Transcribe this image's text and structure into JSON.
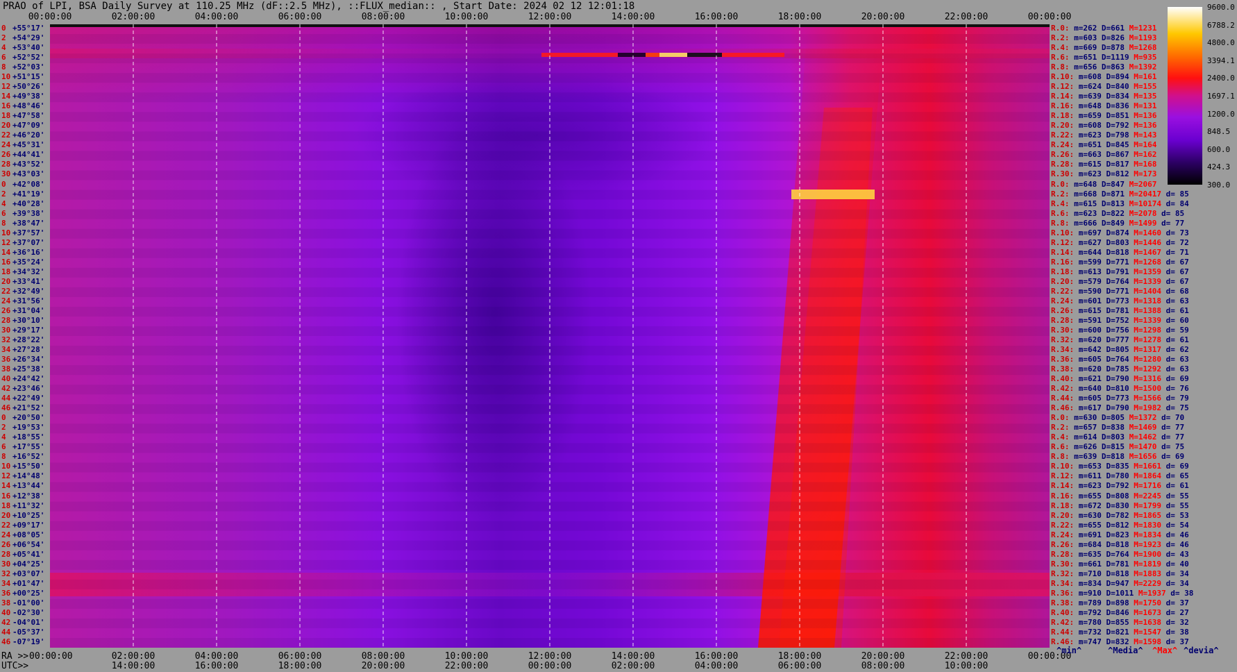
{
  "title": "PRAO of LPI, BSA Daily Survey at 110.25 MHz (dF::2.5 MHz), ::FLUX_median:: , Start Date: 2024 02 12 12:01:18",
  "footer": {
    "ra_label": "RA >>",
    "utc_label": "UTC>>",
    "legend": [
      "^min^",
      "^Media^",
      "^Max^",
      "^devia^"
    ]
  },
  "colors": {
    "background": "#9c9c9c",
    "index": "#cc0000",
    "declination": "#00006e",
    "max": "#ff0000"
  },
  "chart_data": {
    "type": "heatmap",
    "x_top_labels": [
      "00:00:00",
      "02:00:00",
      "04:00:00",
      "06:00:00",
      "08:00:00",
      "10:00:00",
      "12:00:00",
      "14:00:00",
      "16:00:00",
      "18:00:00",
      "20:00:00",
      "22:00:00",
      "00:00:00"
    ],
    "x_bottom_ra": [
      "00:00:00",
      "02:00:00",
      "04:00:00",
      "06:00:00",
      "08:00:00",
      "10:00:00",
      "12:00:00",
      "14:00:00",
      "16:00:00",
      "18:00:00",
      "20:00:00",
      "22:00:00",
      "00:00:00"
    ],
    "x_bottom_utc": [
      "14:00:00",
      "16:00:00",
      "18:00:00",
      "20:00:00",
      "22:00:00",
      "00:00:00",
      "02:00:00",
      "04:00:00",
      "06:00:00",
      "08:00:00",
      "10:00:00"
    ],
    "colorbar": {
      "ticks": [
        "9600.0",
        "6788.2",
        "4800.0",
        "3394.1",
        "2400.0",
        "1697.1",
        "1200.0",
        "848.5",
        "600.0",
        "424.3",
        "300.0"
      ]
    },
    "rows": [
      {
        "i": "0",
        "dec": "+55°17'"
      },
      {
        "i": "2",
        "dec": "+54°29'"
      },
      {
        "i": "4",
        "dec": "+53°40'"
      },
      {
        "i": "6",
        "dec": "+52°52'"
      },
      {
        "i": "8",
        "dec": "+52°03'"
      },
      {
        "i": "10",
        "dec": "+51°15'"
      },
      {
        "i": "12",
        "dec": "+50°26'"
      },
      {
        "i": "14",
        "dec": "+49°38'"
      },
      {
        "i": "16",
        "dec": "+48°46'"
      },
      {
        "i": "18",
        "dec": "+47°58'"
      },
      {
        "i": "20",
        "dec": "+47°09'"
      },
      {
        "i": "22",
        "dec": "+46°20'"
      },
      {
        "i": "24",
        "dec": "+45°31'"
      },
      {
        "i": "26",
        "dec": "+44°41'"
      },
      {
        "i": "28",
        "dec": "+43°52'"
      },
      {
        "i": "30",
        "dec": "+43°03'"
      },
      {
        "i": "0",
        "dec": "+42°08'"
      },
      {
        "i": "2",
        "dec": "+41°19'"
      },
      {
        "i": "4",
        "dec": "+40°28'"
      },
      {
        "i": "6",
        "dec": "+39°38'"
      },
      {
        "i": "8",
        "dec": "+38°47'"
      },
      {
        "i": "10",
        "dec": "+37°57'"
      },
      {
        "i": "12",
        "dec": "+37°07'"
      },
      {
        "i": "14",
        "dec": "+36°16'"
      },
      {
        "i": "16",
        "dec": "+35°24'"
      },
      {
        "i": "18",
        "dec": "+34°32'"
      },
      {
        "i": "20",
        "dec": "+33°41'"
      },
      {
        "i": "22",
        "dec": "+32°49'"
      },
      {
        "i": "24",
        "dec": "+31°56'"
      },
      {
        "i": "26",
        "dec": "+31°04'"
      },
      {
        "i": "28",
        "dec": "+30°10'"
      },
      {
        "i": "30",
        "dec": "+29°17'"
      },
      {
        "i": "32",
        "dec": "+28°22'"
      },
      {
        "i": "34",
        "dec": "+27°28'"
      },
      {
        "i": "36",
        "dec": "+26°34'"
      },
      {
        "i": "38",
        "dec": "+25°38'"
      },
      {
        "i": "40",
        "dec": "+24°42'"
      },
      {
        "i": "42",
        "dec": "+23°46'"
      },
      {
        "i": "44",
        "dec": "+22°49'"
      },
      {
        "i": "46",
        "dec": "+21°52'"
      },
      {
        "i": "0",
        "dec": "+20°50'"
      },
      {
        "i": "2",
        "dec": "+19°53'"
      },
      {
        "i": "4",
        "dec": "+18°55'"
      },
      {
        "i": "6",
        "dec": "+17°55'"
      },
      {
        "i": "8",
        "dec": "+16°52'"
      },
      {
        "i": "10",
        "dec": "+15°50'"
      },
      {
        "i": "12",
        "dec": "+14°48'"
      },
      {
        "i": "14",
        "dec": "+13°44'"
      },
      {
        "i": "16",
        "dec": "+12°38'"
      },
      {
        "i": "18",
        "dec": "+11°32'"
      },
      {
        "i": "20",
        "dec": "+10°25'"
      },
      {
        "i": "22",
        "dec": "+09°17'"
      },
      {
        "i": "24",
        "dec": "+08°05'"
      },
      {
        "i": "26",
        "dec": "+06°54'"
      },
      {
        "i": "28",
        "dec": "+05°41'"
      },
      {
        "i": "30",
        "dec": "+04°25'"
      },
      {
        "i": "32",
        "dec": "+03°07'"
      },
      {
        "i": "34",
        "dec": "+01°47'"
      },
      {
        "i": "36",
        "dec": "+00°25'"
      },
      {
        "i": "38",
        "dec": "-01°00'"
      },
      {
        "i": "40",
        "dec": "-02°30'"
      },
      {
        "i": "42",
        "dec": "-04°01'"
      },
      {
        "i": "44",
        "dec": "-05°37'"
      },
      {
        "i": "46",
        "dec": "-07°19'"
      }
    ],
    "stats": [
      {
        "r": "R.0:",
        "min": "262",
        "med": "661",
        "max": "1231",
        "d": ""
      },
      {
        "r": "R.2:",
        "min": "603",
        "med": "826",
        "max": "1193",
        "d": ""
      },
      {
        "r": "R.4:",
        "min": "669",
        "med": "878",
        "max": "1268",
        "d": ""
      },
      {
        "r": "R.6:",
        "min": "651",
        "med": "1119",
        "max": "935",
        "d": ""
      },
      {
        "r": "R.8:",
        "min": "656",
        "med": "863",
        "max": "1392",
        "d": ""
      },
      {
        "r": "R.10:",
        "min": "608",
        "med": "894",
        "max": "161",
        "d": ""
      },
      {
        "r": "R.12:",
        "min": "624",
        "med": "840",
        "max": "155",
        "d": ""
      },
      {
        "r": "R.14:",
        "min": "639",
        "med": "834",
        "max": "135",
        "d": ""
      },
      {
        "r": "R.16:",
        "min": "648",
        "med": "836",
        "max": "131",
        "d": ""
      },
      {
        "r": "R.18:",
        "min": "659",
        "med": "851",
        "max": "136",
        "d": ""
      },
      {
        "r": "R.20:",
        "min": "608",
        "med": "792",
        "max": "136",
        "d": ""
      },
      {
        "r": "R.22:",
        "min": "623",
        "med": "798",
        "max": "143",
        "d": ""
      },
      {
        "r": "R.24:",
        "min": "651",
        "med": "845",
        "max": "164",
        "d": ""
      },
      {
        "r": "R.26:",
        "min": "663",
        "med": "867",
        "max": "162",
        "d": ""
      },
      {
        "r": "R.28:",
        "min": "615",
        "med": "817",
        "max": "168",
        "d": ""
      },
      {
        "r": "R.30:",
        "min": "623",
        "med": "812",
        "max": "173",
        "d": ""
      },
      {
        "r": "R.0:",
        "min": "648",
        "med": "847",
        "max": "2067",
        "d": ""
      },
      {
        "r": "R.2:",
        "min": "668",
        "med": "871",
        "max": "20417",
        "d": "85"
      },
      {
        "r": "R.4:",
        "min": "615",
        "med": "813",
        "max": "10174",
        "d": "84"
      },
      {
        "r": "R.6:",
        "min": "623",
        "med": "822",
        "max": "2078",
        "d": "85"
      },
      {
        "r": "R.8:",
        "min": "666",
        "med": "849",
        "max": "1499",
        "d": "77"
      },
      {
        "r": "R.10:",
        "min": "697",
        "med": "874",
        "max": "1460",
        "d": "73"
      },
      {
        "r": "R.12:",
        "min": "627",
        "med": "803",
        "max": "1446",
        "d": "72"
      },
      {
        "r": "R.14:",
        "min": "644",
        "med": "818",
        "max": "1467",
        "d": "71"
      },
      {
        "r": "R.16:",
        "min": "599",
        "med": "771",
        "max": "1268",
        "d": "67"
      },
      {
        "r": "R.18:",
        "min": "613",
        "med": "791",
        "max": "1359",
        "d": "67"
      },
      {
        "r": "R.20:",
        "min": "579",
        "med": "764",
        "max": "1339",
        "d": "67"
      },
      {
        "r": "R.22:",
        "min": "590",
        "med": "771",
        "max": "1404",
        "d": "68"
      },
      {
        "r": "R.24:",
        "min": "601",
        "med": "773",
        "max": "1318",
        "d": "63"
      },
      {
        "r": "R.26:",
        "min": "615",
        "med": "781",
        "max": "1388",
        "d": "61"
      },
      {
        "r": "R.28:",
        "min": "591",
        "med": "752",
        "max": "1339",
        "d": "60"
      },
      {
        "r": "R.30:",
        "min": "600",
        "med": "756",
        "max": "1298",
        "d": "59"
      },
      {
        "r": "R.32:",
        "min": "620",
        "med": "777",
        "max": "1278",
        "d": "61"
      },
      {
        "r": "R.34:",
        "min": "642",
        "med": "805",
        "max": "1317",
        "d": "62"
      },
      {
        "r": "R.36:",
        "min": "605",
        "med": "764",
        "max": "1280",
        "d": "63"
      },
      {
        "r": "R.38:",
        "min": "620",
        "med": "785",
        "max": "1292",
        "d": "63"
      },
      {
        "r": "R.40:",
        "min": "621",
        "med": "790",
        "max": "1316",
        "d": "69"
      },
      {
        "r": "R.42:",
        "min": "640",
        "med": "810",
        "max": "1500",
        "d": "76"
      },
      {
        "r": "R.44:",
        "min": "605",
        "med": "773",
        "max": "1566",
        "d": "79"
      },
      {
        "r": "R.46:",
        "min": "617",
        "med": "790",
        "max": "1982",
        "d": "75"
      },
      {
        "r": "R.0:",
        "min": "630",
        "med": "805",
        "max": "1372",
        "d": "70"
      },
      {
        "r": "R.2:",
        "min": "657",
        "med": "838",
        "max": "1469",
        "d": "77"
      },
      {
        "r": "R.4:",
        "min": "614",
        "med": "803",
        "max": "1462",
        "d": "77"
      },
      {
        "r": "R.6:",
        "min": "626",
        "med": "815",
        "max": "1470",
        "d": "75"
      },
      {
        "r": "R.8:",
        "min": "639",
        "med": "818",
        "max": "1656",
        "d": "69"
      },
      {
        "r": "R.10:",
        "min": "653",
        "med": "835",
        "max": "1661",
        "d": "69"
      },
      {
        "r": "R.12:",
        "min": "611",
        "med": "780",
        "max": "1864",
        "d": "65"
      },
      {
        "r": "R.14:",
        "min": "623",
        "med": "792",
        "max": "1716",
        "d": "61"
      },
      {
        "r": "R.16:",
        "min": "655",
        "med": "808",
        "max": "2245",
        "d": "55"
      },
      {
        "r": "R.18:",
        "min": "672",
        "med": "830",
        "max": "1799",
        "d": "55"
      },
      {
        "r": "R.20:",
        "min": "630",
        "med": "782",
        "max": "1865",
        "d": "53"
      },
      {
        "r": "R.22:",
        "min": "655",
        "med": "812",
        "max": "1830",
        "d": "54"
      },
      {
        "r": "R.24:",
        "min": "691",
        "med": "823",
        "max": "1834",
        "d": "46"
      },
      {
        "r": "R.26:",
        "min": "684",
        "med": "818",
        "max": "1923",
        "d": "46"
      },
      {
        "r": "R.28:",
        "min": "635",
        "med": "764",
        "max": "1900",
        "d": "43"
      },
      {
        "r": "R.30:",
        "min": "661",
        "med": "781",
        "max": "1819",
        "d": "40"
      },
      {
        "r": "R.32:",
        "min": "710",
        "med": "818",
        "max": "1883",
        "d": "34"
      },
      {
        "r": "R.34:",
        "min": "834",
        "med": "947",
        "max": "2229",
        "d": "34"
      },
      {
        "r": "R.36:",
        "min": "910",
        "med": "1011",
        "max": "1937",
        "d": "38"
      },
      {
        "r": "R.38:",
        "min": "789",
        "med": "898",
        "max": "1750",
        "d": "37"
      },
      {
        "r": "R.40:",
        "min": "792",
        "med": "846",
        "max": "1673",
        "d": "27"
      },
      {
        "r": "R.42:",
        "min": "780",
        "med": "855",
        "max": "1638",
        "d": "32"
      },
      {
        "r": "R.44:",
        "min": "732",
        "med": "821",
        "max": "1547",
        "d": "38"
      },
      {
        "r": "R.46:",
        "min": "747",
        "med": "832",
        "max": "1598",
        "d": "37"
      }
    ]
  }
}
